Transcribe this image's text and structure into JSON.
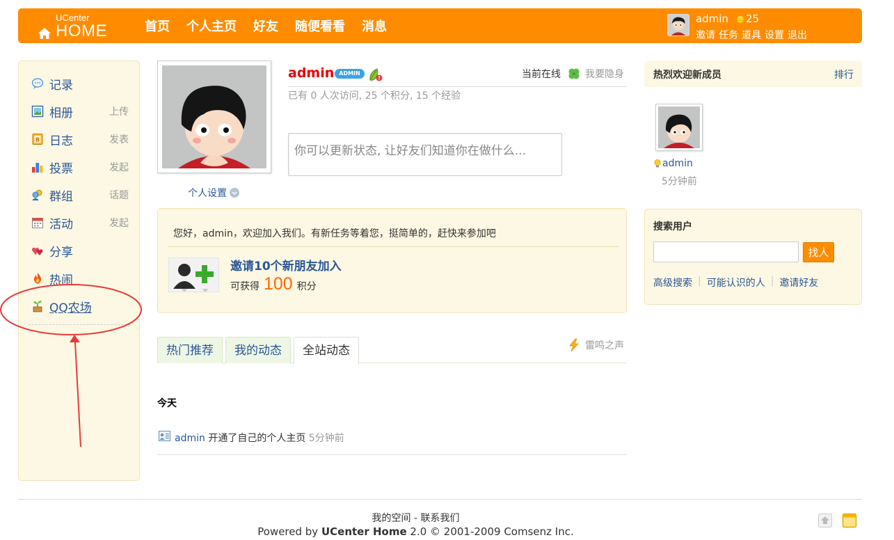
{
  "header": {
    "logo_small": "UCenter",
    "logo_big": "HOME",
    "nav": [
      "首页",
      "个人主页",
      "好友",
      "随便看看",
      "消息"
    ],
    "user_name": "admin",
    "coin_count": "25",
    "user_links": [
      "邀请",
      "任务",
      "道具",
      "设置",
      "退出"
    ],
    "bar_color": "#ff8c00"
  },
  "sidebar": {
    "items": [
      {
        "label": "记录",
        "action": "",
        "icon": "speech-bubble-icon"
      },
      {
        "label": "相册",
        "action": "上传",
        "icon": "photo-icon"
      },
      {
        "label": "日志",
        "action": "发表",
        "icon": "blog-icon"
      },
      {
        "label": "投票",
        "action": "发起",
        "icon": "poll-chart-icon"
      },
      {
        "label": "群组",
        "action": "话题",
        "icon": "group-icon"
      },
      {
        "label": "活动",
        "action": "发起",
        "icon": "calendar-icon"
      },
      {
        "label": "分享",
        "action": "",
        "icon": "hearts-icon"
      },
      {
        "label": "热闹",
        "action": "",
        "icon": "fire-icon"
      },
      {
        "label": "QQ农场",
        "action": "",
        "icon": "sprout-icon"
      }
    ]
  },
  "profile": {
    "name": "admin",
    "badge": "ADMIN",
    "online_status": "当前在线",
    "invisible_link": "我要隐身",
    "stats": "已有 0 人次访问, 25 个积分, 15 个经验",
    "status_placeholder": "你可以更新状态, 让好友们知道你在做什么...",
    "settings_link": "个人设置"
  },
  "task": {
    "welcome": "您好，admin，欢迎加入我们。有新任务等着您，挺简单的，赶快来参加吧",
    "title": "邀请10个新朋友加入",
    "reward_prefix": "可获得",
    "points": "100",
    "reward_suffix": "积分"
  },
  "feed": {
    "tabs": [
      {
        "label": "热门推荐",
        "active": false
      },
      {
        "label": "我的动态",
        "active": false
      },
      {
        "label": "全站动态",
        "active": true
      }
    ],
    "thunder_link": "雷鸣之声",
    "day_label": "今天",
    "entry_user": "admin",
    "entry_text": " 开通了自己的个人主页 ",
    "entry_time": "5分钟前"
  },
  "right": {
    "welcome_title": "热烈欢迎新成员",
    "rank_link": "排行",
    "member_name": "admin",
    "member_time": "5分钟前",
    "search_title": "搜索用户",
    "search_button": "找人",
    "search_value": "",
    "search_links": [
      "高级搜索",
      "可能认识的人",
      "邀请好友"
    ]
  },
  "footer": {
    "link_space": "我的空间",
    "separator": " - ",
    "link_contact": "联系我们",
    "powered_prefix": "Powered by ",
    "powered_brand": "UCenter Home",
    "powered_suffix": " 2.0 © 2001-2009 Comsenz Inc."
  }
}
